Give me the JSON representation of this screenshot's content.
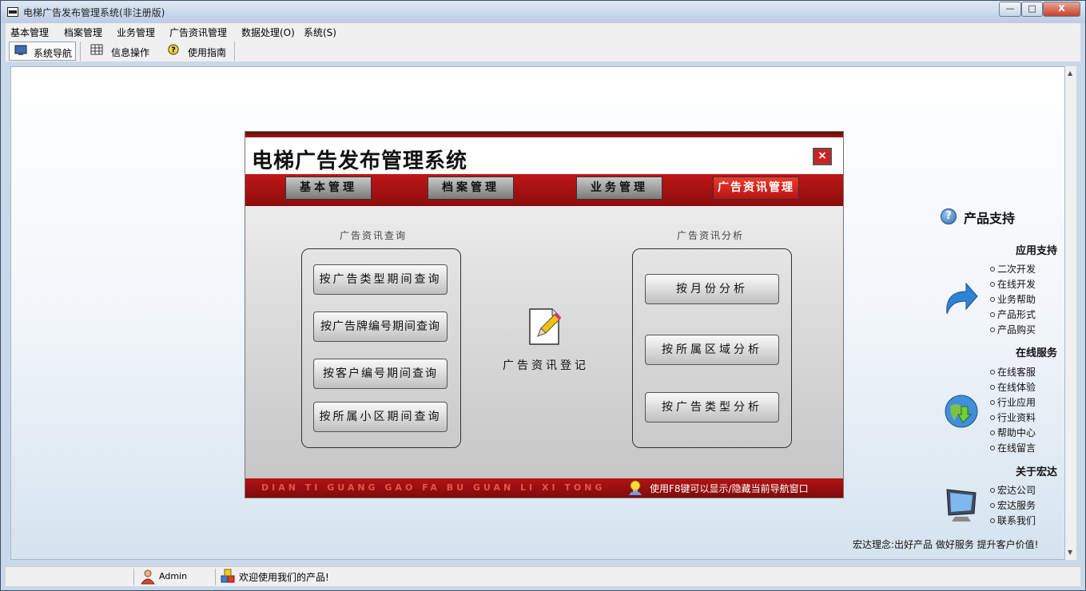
{
  "window": {
    "title": "电梯广告发布管理系统(非注册版)",
    "min_glyph": "—",
    "max_glyph": "□",
    "close_glyph": "X"
  },
  "menu": {
    "items": [
      "基本管理",
      "档案管理",
      "业务管理",
      "广告资讯管理",
      "数据处理(O)",
      "系统(S)"
    ]
  },
  "toolbar": {
    "buttons": [
      {
        "label": "系统导航",
        "icon": "monitor-icon",
        "active": true
      },
      {
        "label": "信息操作",
        "icon": "grid-icon",
        "active": false
      },
      {
        "label": "使用指南",
        "icon": "help-icon",
        "active": false
      }
    ]
  },
  "nav_panel": {
    "title": "电梯广告发布管理系统",
    "close_glyph": "×",
    "tabs": [
      {
        "label": "基本管理",
        "active": false
      },
      {
        "label": "档案管理",
        "active": false
      },
      {
        "label": "业务管理",
        "active": false
      },
      {
        "label": "广告资讯管理",
        "active": true
      }
    ],
    "query_group": {
      "title": "广告资讯查询",
      "buttons": [
        "按广告类型期间查询",
        "按广告牌编号期间查询",
        "按客户编号期间查询",
        "按所属小区期间查询"
      ]
    },
    "register": {
      "label": "广告资讯登记",
      "icon": "document-pencil-icon"
    },
    "analysis_group": {
      "title": "广告资讯分析",
      "buttons": [
        "按月份分析",
        "按所属区域分析",
        "按广告类型分析"
      ]
    },
    "footer": {
      "pinyin": "DIAN TI GUANG GAO FA BU GUAN LI XI TONG",
      "tip": "使用F8键可以显示/隐藏当前导航窗口"
    }
  },
  "support": {
    "title": "产品支持",
    "sections": [
      {
        "title": "应用支持",
        "icon": "arrow-icon",
        "items": [
          "二次开发",
          "在线开发",
          "业务帮助",
          "产品形式",
          "产品购买"
        ]
      },
      {
        "title": "在线服务",
        "icon": "globe-icon",
        "items": [
          "在线客服",
          "在线体验",
          "行业应用",
          "行业资料",
          "帮助中心",
          "在线留言"
        ]
      },
      {
        "title": "关于宏达",
        "icon": "monitor-icon",
        "items": [
          "宏达公司",
          "宏达服务",
          "联系我们"
        ]
      }
    ],
    "motto": "宏达理念:出好产品 做好服务 提升客户价值!"
  },
  "statusbar": {
    "user": "Admin",
    "welcome": "欢迎使用我们的产品!"
  },
  "colors": {
    "accent_red": "#b31313",
    "active_tab": "#e0301f"
  }
}
